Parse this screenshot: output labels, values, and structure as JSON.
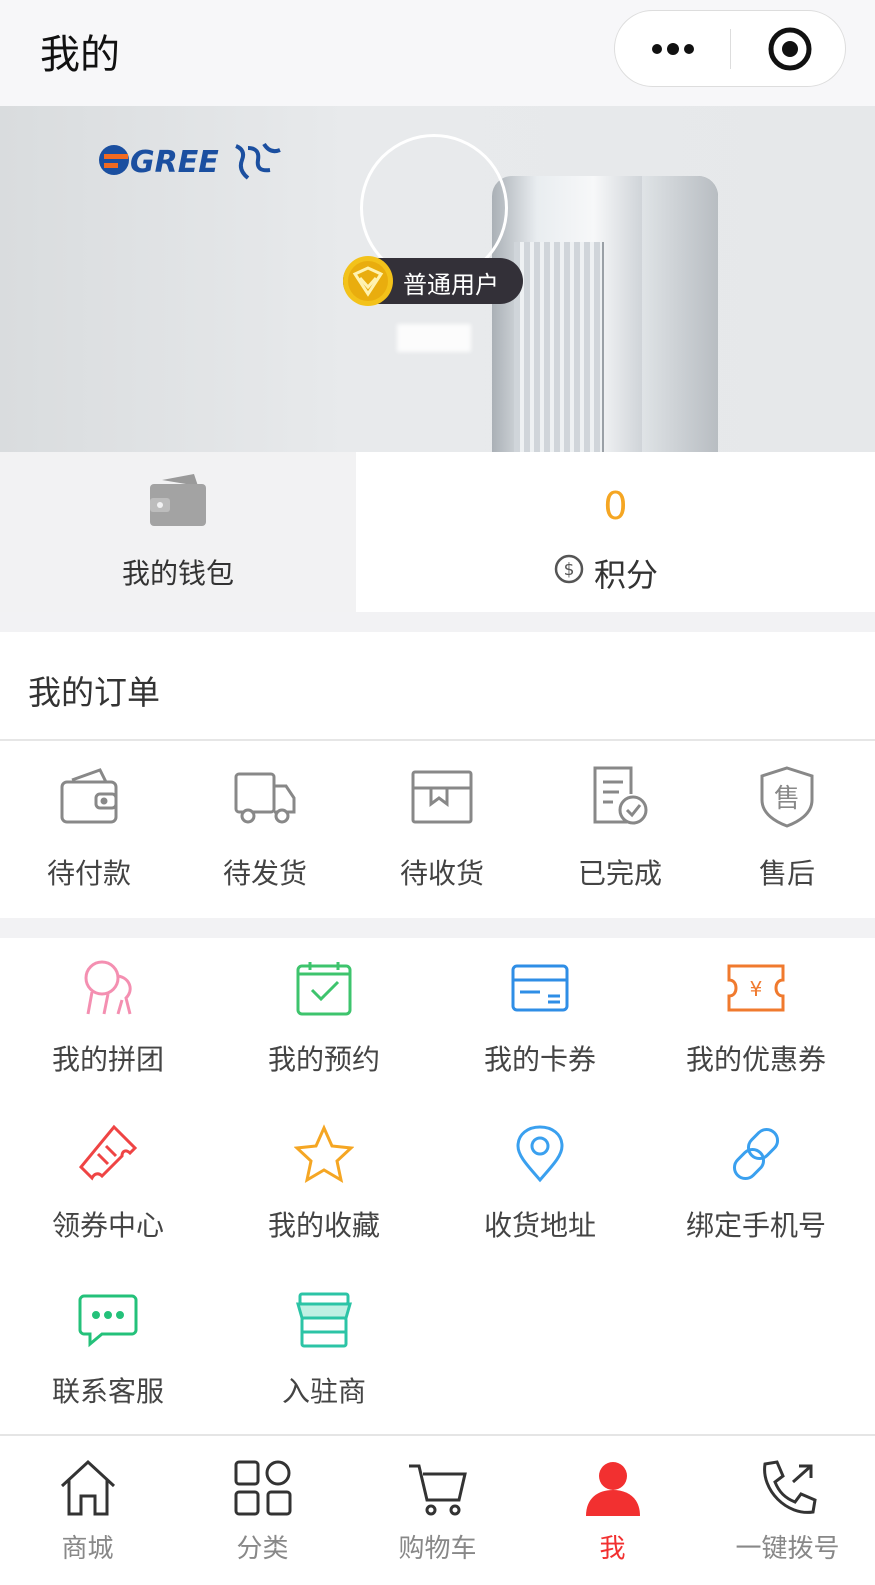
{
  "header": {
    "title": "我的"
  },
  "profile": {
    "brand_icon": "gree-logo",
    "user_level": "普通用户"
  },
  "stats": {
    "wallet_label": "我的钱包",
    "points_value": "0",
    "points_label": "积分"
  },
  "orders": {
    "title": "我的订单",
    "items": [
      {
        "label": "待付款",
        "icon": "wallet-icon"
      },
      {
        "label": "待发货",
        "icon": "truck-icon"
      },
      {
        "label": "待收货",
        "icon": "box-icon"
      },
      {
        "label": "已完成",
        "icon": "document-check-icon"
      },
      {
        "label": "售后",
        "icon": "shield-icon"
      }
    ]
  },
  "services": {
    "items": [
      {
        "label": "我的拼团",
        "icon": "group-icon",
        "color": "#f48fb1"
      },
      {
        "label": "我的预约",
        "icon": "calendar-check-icon",
        "color": "#3ec46d"
      },
      {
        "label": "我的卡券",
        "icon": "card-icon",
        "color": "#2f8ee6"
      },
      {
        "label": "我的优惠券",
        "icon": "coupon-yen-icon",
        "color": "#f07a2e"
      },
      {
        "label": "领券中心",
        "icon": "ticket-icon",
        "color": "#ef4444"
      },
      {
        "label": "我的收藏",
        "icon": "star-icon",
        "color": "#f5a623"
      },
      {
        "label": "收货地址",
        "icon": "location-pin-icon",
        "color": "#3aa0ef"
      },
      {
        "label": "绑定手机号",
        "icon": "link-icon",
        "color": "#3aa0ef"
      },
      {
        "label": "联系客服",
        "icon": "chat-bubble-icon",
        "color": "#24c17a"
      },
      {
        "label": "入驻商",
        "icon": "storefront-icon",
        "color": "#2cc4a6"
      }
    ]
  },
  "tabbar": {
    "items": [
      {
        "label": "商城",
        "icon": "home-icon"
      },
      {
        "label": "分类",
        "icon": "category-icon"
      },
      {
        "label": "购物车",
        "icon": "cart-icon"
      },
      {
        "label": "我",
        "icon": "person-icon",
        "active": true
      },
      {
        "label": "一键拨号",
        "icon": "phone-icon"
      }
    ]
  },
  "colors": {
    "accent_red": "#f23030",
    "points_orange": "#f5a623"
  }
}
